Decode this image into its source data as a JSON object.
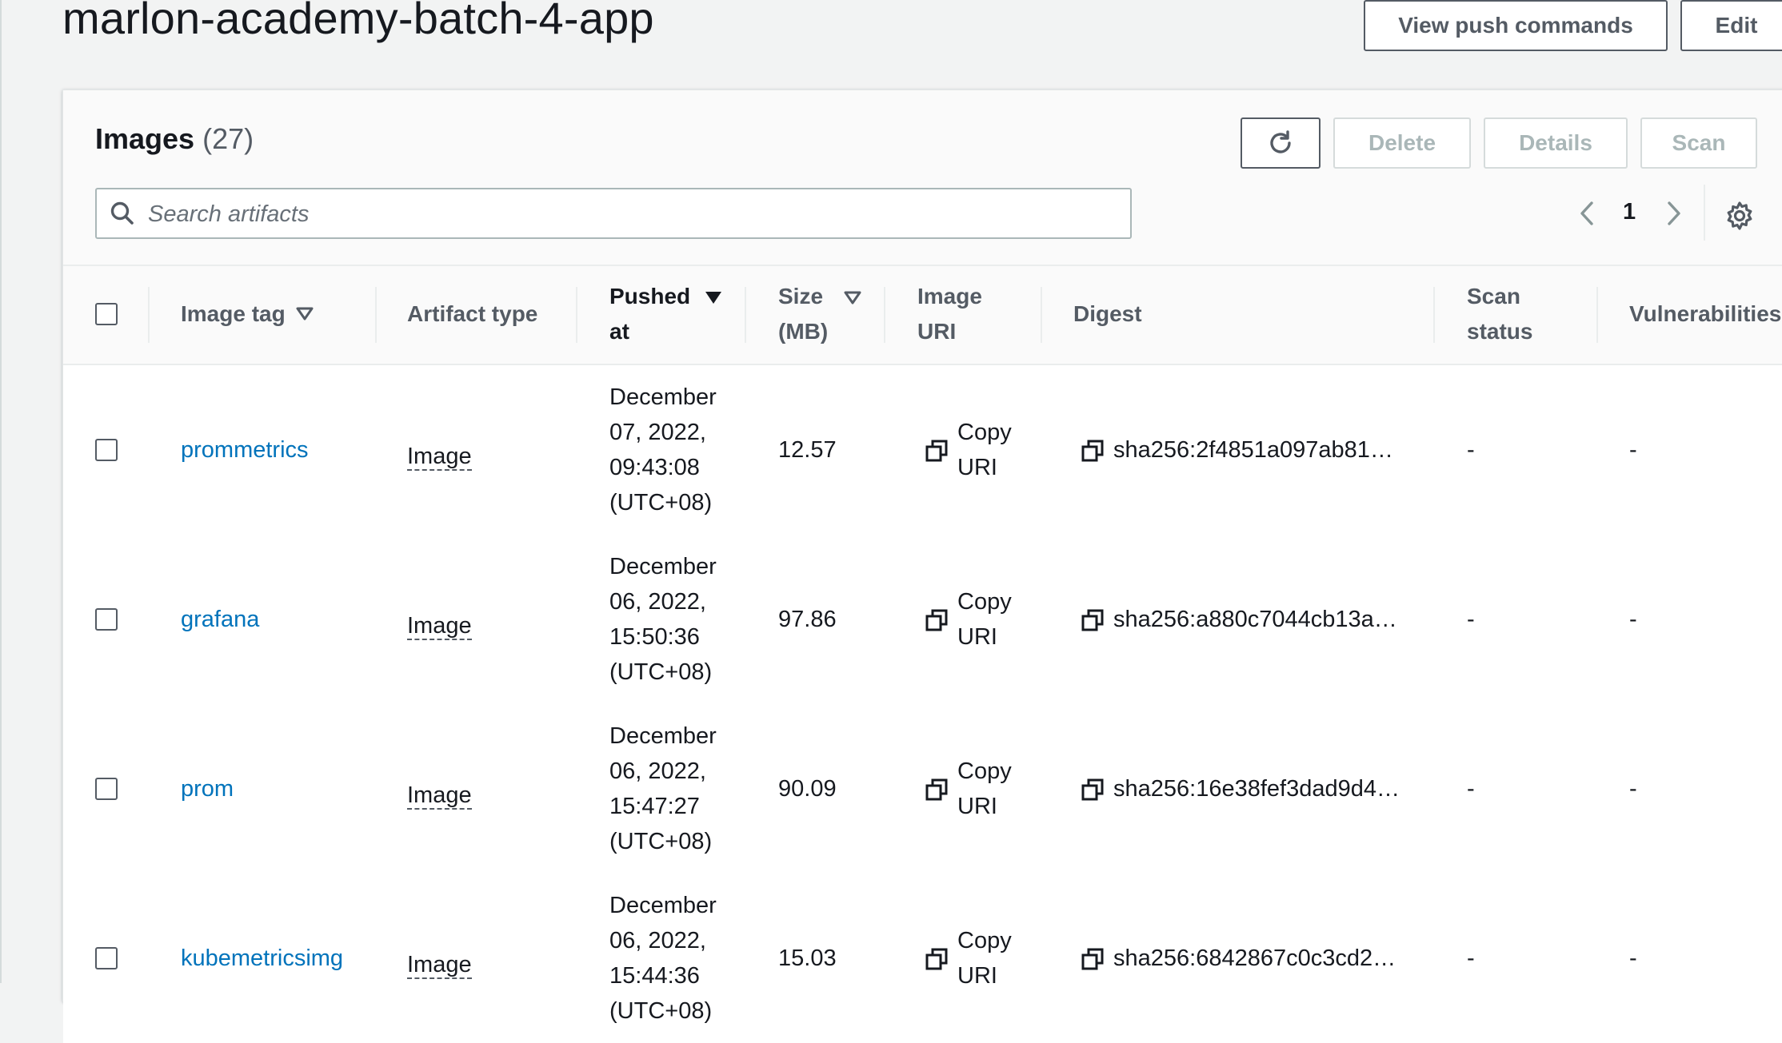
{
  "page": {
    "title": "marlon-academy-batch-4-app",
    "view_push_commands": "View push commands",
    "edit": "Edit"
  },
  "panel": {
    "title": "Images",
    "count": "(27)",
    "buttons": {
      "delete": "Delete",
      "details": "Details",
      "scan": "Scan"
    },
    "search_placeholder": "Search artifacts",
    "page_number": "1"
  },
  "table": {
    "headers": {
      "image_tag": "Image tag",
      "artifact_type": "Artifact type",
      "pushed_at_1": "Pushed",
      "pushed_at_2": "at",
      "size_1": "Size",
      "size_2": "(MB)",
      "uri_1": "Image",
      "uri_2": "URI",
      "digest": "Digest",
      "scan_1": "Scan",
      "scan_2": "status",
      "vulnerabilities": "Vulnerabilities"
    },
    "rows": [
      {
        "tag": "prommetrics",
        "type": "Image",
        "pushed": [
          "December",
          "07, 2022,",
          "09:43:08",
          "(UTC+08)"
        ],
        "size": "12.57",
        "copy_1": "Copy",
        "copy_2": "URI",
        "digest": "sha256:2f4851a097ab81…",
        "scan": "-",
        "vuln": "-"
      },
      {
        "tag": "grafana",
        "type": "Image",
        "pushed": [
          "December",
          "06, 2022,",
          "15:50:36",
          "(UTC+08)"
        ],
        "size": "97.86",
        "copy_1": "Copy",
        "copy_2": "URI",
        "digest": "sha256:a880c7044cb13a…",
        "scan": "-",
        "vuln": "-"
      },
      {
        "tag": "prom",
        "type": "Image",
        "pushed": [
          "December",
          "06, 2022,",
          "15:47:27",
          "(UTC+08)"
        ],
        "size": "90.09",
        "copy_1": "Copy",
        "copy_2": "URI",
        "digest": "sha256:16e38fef3dad9d4…",
        "scan": "-",
        "vuln": "-"
      },
      {
        "tag": "kubemetricsimg",
        "type": "Image",
        "pushed": [
          "December",
          "06, 2022,",
          "15:44:36",
          "(UTC+08)"
        ],
        "size": "15.03",
        "copy_1": "Copy",
        "copy_2": "URI",
        "digest": "sha256:6842867c0c3cd2…",
        "scan": "-",
        "vuln": "-"
      }
    ]
  }
}
